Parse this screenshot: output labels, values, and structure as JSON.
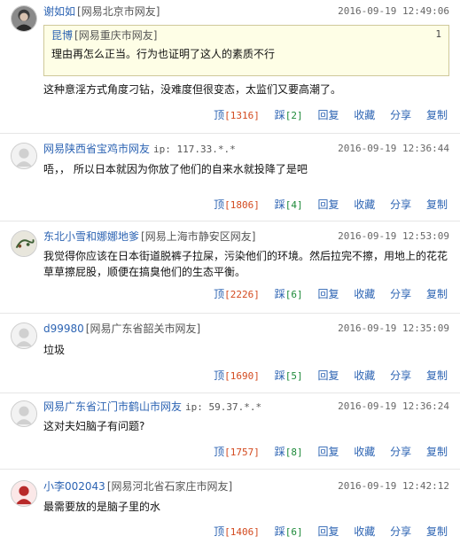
{
  "labels": {
    "up": "顶",
    "down": "踩",
    "reply": "回复",
    "fav": "收藏",
    "share": "分享",
    "copy": "复制"
  },
  "comments": [
    {
      "user": "谢如如",
      "location": "[网易北京市网友]",
      "ip": "",
      "time": "2016-09-19 12:49:06",
      "avatar": "photo",
      "quote": {
        "user": "昆博",
        "location": "[网易重庆市网友]",
        "floor": "1",
        "text": "理由再怎么正当。行为也证明了这人的素质不行"
      },
      "text": "这种意淫方式角度刁钻，没难度但很变态，太监们又要高潮了。",
      "up": "[1316]",
      "down": "[2]"
    },
    {
      "user": "网易陕西省宝鸡市网友",
      "location": "",
      "ip": "ip: 117.33.*.*",
      "time": "2016-09-19 12:36:44",
      "avatar": "default",
      "text": "唔，，  所以日本就因为你放了他们的自来水就投降了是吧",
      "up": "[1806]",
      "down": "[4]"
    },
    {
      "user": "东北小雪和娜娜地爹",
      "location": "[网易上海市静安区网友]",
      "ip": "",
      "time": "2016-09-19 12:53:09",
      "avatar": "art",
      "text": "我觉得你应该在日本街道脱裤子拉屎，污染他们的环境。然后拉完不擦，用地上的花花草草擦屁股，顺便在搞臭他们的生态平衡。",
      "up": "[2226]",
      "down": "[6]"
    },
    {
      "user": "d99980",
      "location": "[网易广东省韶关市网友]",
      "ip": "",
      "time": "2016-09-19 12:35:09",
      "avatar": "default",
      "text": "垃圾",
      "up": "[1690]",
      "down": "[5]"
    },
    {
      "user": "网易广东省江门市鹤山市网友",
      "location": "",
      "ip": "ip: 59.37.*.*",
      "time": "2016-09-19 12:36:24",
      "avatar": "default",
      "text": "这对夫妇脑子有问题?",
      "up": "[1757]",
      "down": "[8]"
    },
    {
      "user": "小李002043",
      "location": "[网易河北省石家庄市网友]",
      "ip": "",
      "time": "2016-09-19 12:42:12",
      "avatar": "red",
      "text": "最需要放的是脑子里的水",
      "up": "[1406]",
      "down": "[6]"
    }
  ]
}
